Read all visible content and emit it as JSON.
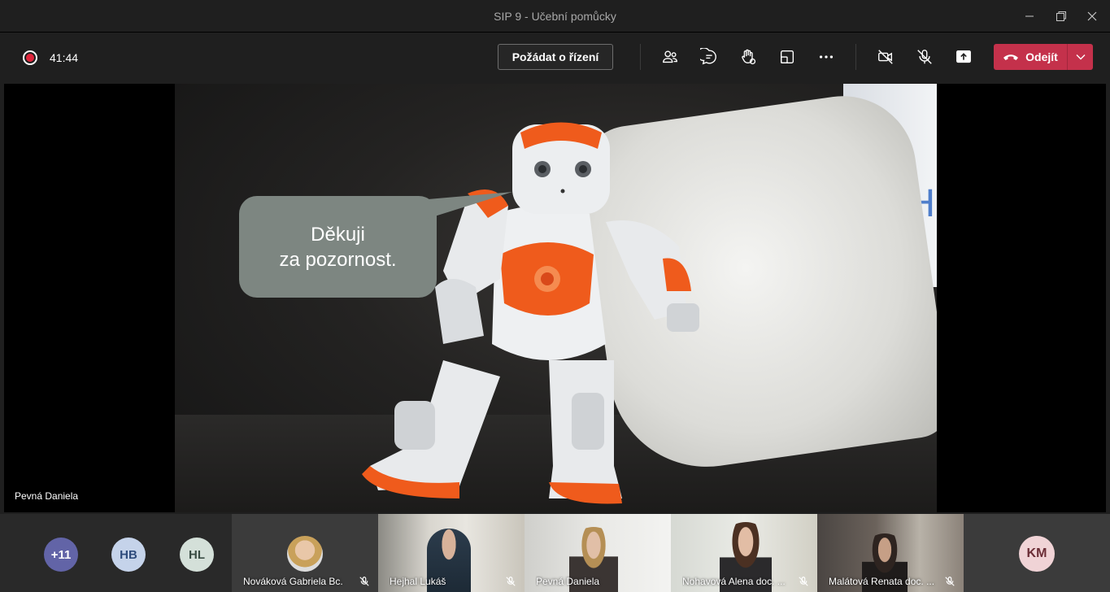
{
  "window": {
    "title": "SIP 9 - Učební pomůcky",
    "controls": [
      "minimize-icon",
      "restore-icon",
      "close-icon"
    ]
  },
  "toolbar": {
    "recording_icon": "record-icon",
    "timer": "41:44",
    "request_control_label": "Požádat o řízení",
    "tools": [
      "participants-icon",
      "chat-icon",
      "raise-hand-icon",
      "room-icon",
      "more-icon"
    ],
    "device_tools": [
      "camera-off-icon",
      "mic-off-icon",
      "share-icon"
    ],
    "leave_label": "Odejít",
    "leave_color": "#c4314b"
  },
  "stage": {
    "speaker_name": "Pevná Daniela",
    "slide_text_line1": "Děkuji",
    "slide_text_line2": "za pozornost."
  },
  "participants": {
    "overflow": {
      "label": "+11",
      "color": "#6264a7"
    },
    "avatars": [
      {
        "initials": "HB",
        "color": "#c5d3ea",
        "text_color": "#2f4c7d"
      },
      {
        "initials": "HL",
        "color": "#d4e0d9",
        "text_color": "#3a4d44"
      }
    ],
    "tiles": [
      {
        "name": "Nováková Gabriela Bc.",
        "muted": true
      },
      {
        "name": "Hejhal Lukáš",
        "muted": true
      },
      {
        "name": "Pevná Daniela",
        "muted": false
      },
      {
        "name": "Nohavová Alena doc. ...",
        "muted": true
      },
      {
        "name": "Malátová Renata doc. ...",
        "muted": true
      }
    ],
    "last_avatar": {
      "initials": "KM",
      "color": "#f0d3d6",
      "text_color": "#6b2d36"
    }
  }
}
